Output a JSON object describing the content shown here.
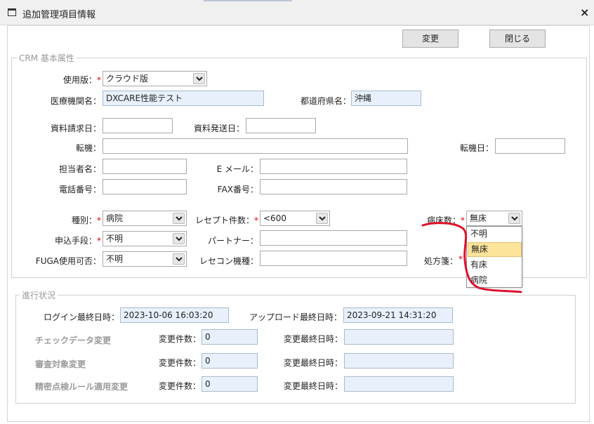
{
  "window": {
    "title": "追加管理項目情報",
    "close_glyph": "×"
  },
  "toolbar": {
    "change_label": "変更",
    "close_label": "閉じる"
  },
  "crm": {
    "legend": "CRM 基本属性",
    "version": {
      "label": "使用版：",
      "value": "クラウド版"
    },
    "institution": {
      "label": "医療機関名：",
      "value": "DXCARE性能テスト"
    },
    "prefecture": {
      "label": "都道府県名：",
      "value": "沖縄"
    },
    "doc_request": {
      "label": "資料請求日：",
      "value": ""
    },
    "doc_sent": {
      "label": "資料発送日：",
      "value": ""
    },
    "transfer": {
      "label": "転機：",
      "value": ""
    },
    "transfer_date": {
      "label": "転機日：",
      "value": ""
    },
    "person": {
      "label": "担当者名：",
      "value": ""
    },
    "email": {
      "label": "E メール：",
      "value": ""
    },
    "phone": {
      "label": "電話番号：",
      "value": ""
    },
    "fax": {
      "label": "FAX番号：",
      "value": ""
    },
    "type": {
      "label": "種別：",
      "value": "病院"
    },
    "receipt": {
      "label": "レセプト件数：",
      "value": "<600"
    },
    "beds": {
      "label": "病床数：",
      "value": "無床"
    },
    "apply": {
      "label": "申込手段：",
      "value": "不明"
    },
    "partner": {
      "label": "パートナー：",
      "value": ""
    },
    "fuga": {
      "label": "FUGA使用可否：",
      "value": "不明"
    },
    "rececon": {
      "label": "レセコン機種：",
      "value": ""
    },
    "prescription": {
      "label": "処方箋：",
      "value": ""
    },
    "required_mark": "*"
  },
  "beds_dropdown": {
    "options": [
      "不明",
      "無床",
      "有床",
      "病院"
    ],
    "selected_index": 1
  },
  "progress": {
    "legend": "進行状況",
    "login": {
      "label": "ログイン最終日時：",
      "value": "2023-10-06 16:03:20"
    },
    "upload": {
      "label": "アップロード最終日時：",
      "value": "2023-09-21 14:31:20"
    },
    "rows": [
      {
        "title": "チェックデータ変更",
        "count_label": "変更件数：",
        "count": "0",
        "date_label": "変更最終日時：",
        "date": ""
      },
      {
        "title": "審査対象変更",
        "count_label": "変更件数：",
        "count": "0",
        "date_label": "変更最終日時：",
        "date": ""
      },
      {
        "title": "精密点検ルール適用変更",
        "count_label": "変更件数：",
        "count": "0",
        "date_label": "変更最終日時：",
        "date": ""
      }
    ]
  },
  "colors": {
    "annotation_red": "#e0102a",
    "readonly_bg": "#e8f1fb",
    "highlight": "#fde49b"
  },
  "icons": {
    "window": "window-icon",
    "select_arrow": "chevron-down-icon",
    "close": "close-icon"
  }
}
